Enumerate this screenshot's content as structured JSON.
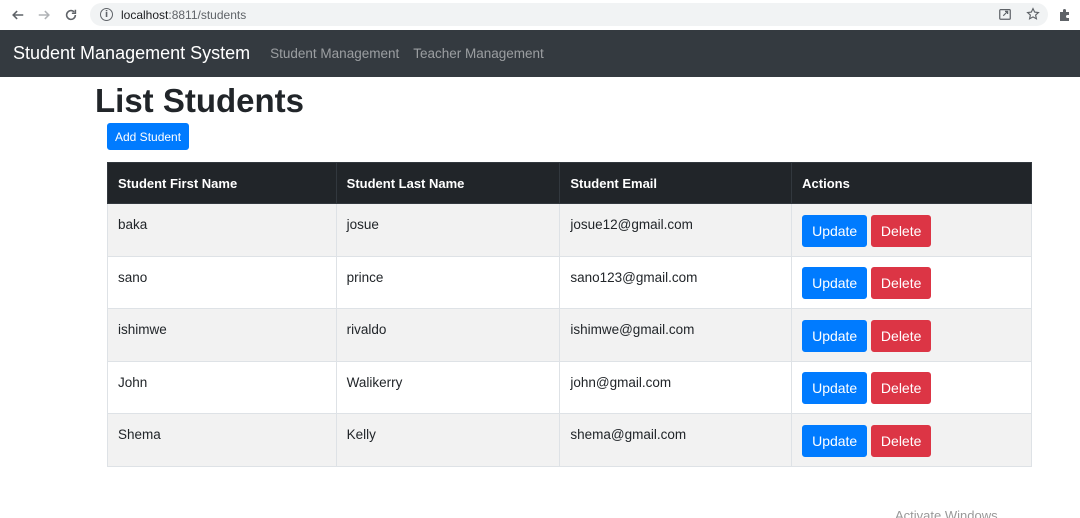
{
  "browser": {
    "url_host": "localhost",
    "url_path": ":8811/students"
  },
  "navbar": {
    "brand": "Student Management System",
    "links": [
      "Student Management",
      "Teacher Management"
    ]
  },
  "page": {
    "title": "List Students",
    "add_button": "Add Student"
  },
  "table": {
    "headers": [
      "Student First Name",
      "Student Last Name",
      "Student Email",
      "Actions"
    ],
    "rows": [
      {
        "first": "baka",
        "last": "josue",
        "email": "josue12@gmail.com"
      },
      {
        "first": "sano",
        "last": "prince",
        "email": "sano123@gmail.com"
      },
      {
        "first": "ishimwe",
        "last": "rivaldo",
        "email": "ishimwe@gmail.com"
      },
      {
        "first": "John",
        "last": "Walikerry",
        "email": "john@gmail.com"
      },
      {
        "first": "Shema",
        "last": "Kelly",
        "email": "shema@gmail.com"
      }
    ],
    "update_label": "Update",
    "delete_label": "Delete"
  },
  "watermark": "Activate Windows",
  "colors": {
    "primary": "#007bff",
    "danger": "#dc3545",
    "navbar": "#343a40",
    "table_header": "#212529"
  }
}
